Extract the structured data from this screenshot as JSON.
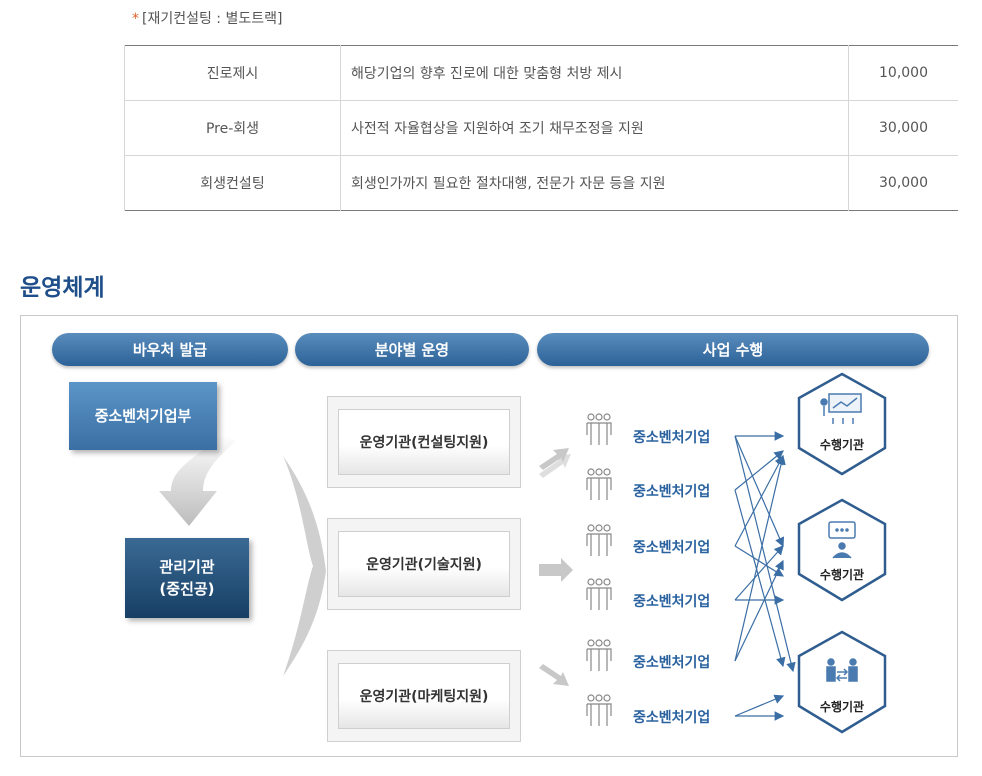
{
  "note": {
    "star": "*",
    "text": "[재기컨설팅 : 별도트랙]"
  },
  "fee_table": {
    "rows": [
      {
        "name": "진로제시",
        "description": "해당기업의 향후 진로에 대한 맞춤형 처방 제시",
        "amount": "10,000"
      },
      {
        "name": "Pre-회생",
        "description": "사전적 자율협상을 지원하여 조기 채무조정을 지원",
        "amount": "30,000"
      },
      {
        "name": "회생컨설팅",
        "description": "회생인가까지 필요한 절차대행, 전문가 자문 등을 지원",
        "amount": "30,000"
      }
    ]
  },
  "section_title": "운영체계",
  "diagram": {
    "headers": [
      "바우처 발급",
      "분야별 운영",
      "사업 수행"
    ],
    "ministry": "중소벤처기업부",
    "manager": {
      "line1": "관리기관",
      "line2": "(중진공)"
    },
    "operators": [
      "운영기관(컨설팅지원)",
      "운영기관(기술지원)",
      "운영기관(마케팅지원)"
    ],
    "sme_label": "중소벤처기업",
    "performer": "수행기관",
    "accent_color": "#2c6298",
    "icons": [
      "people-group-icon",
      "presentation-icon",
      "speech-bubble-icon",
      "exchange-icon"
    ]
  }
}
